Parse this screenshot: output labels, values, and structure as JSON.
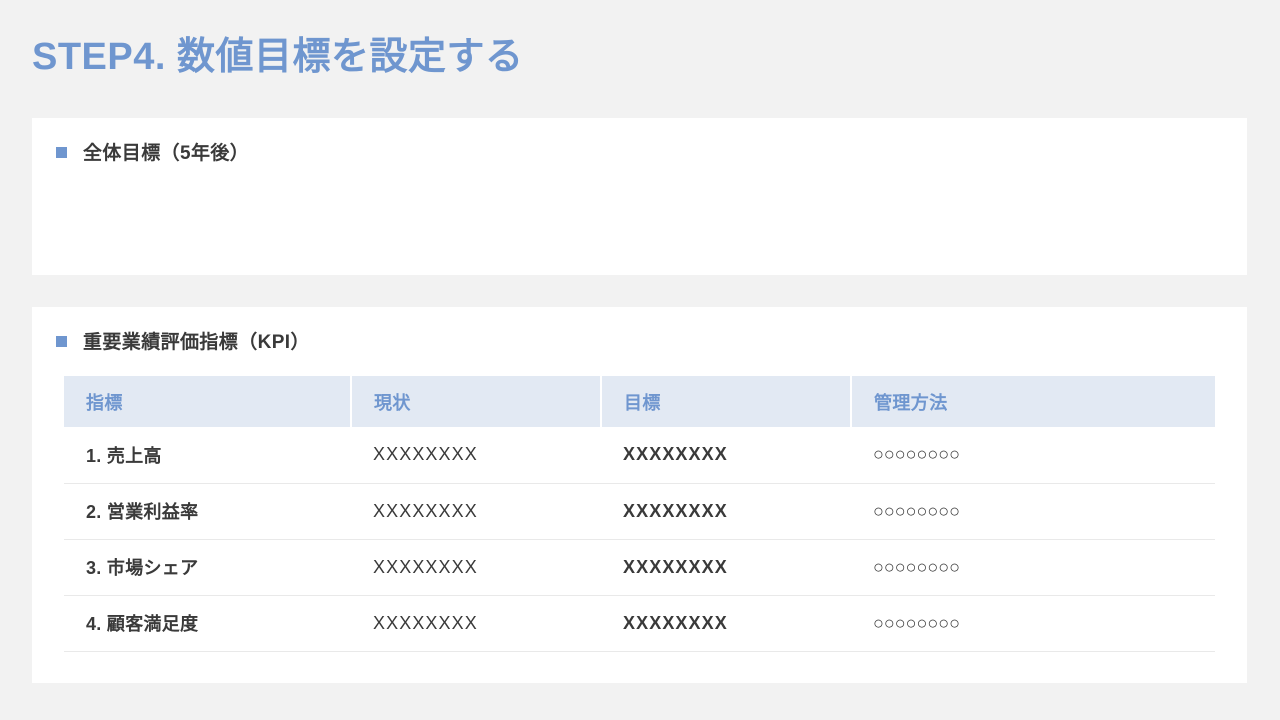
{
  "slide": {
    "title": "STEP4. 数値目標を設定する",
    "accent_color": "#6f96cf",
    "background_color": "#f2f2f2",
    "card_color": "#ffffff"
  },
  "goal_card": {
    "bullet_icon": "square-bullet-icon",
    "heading": "全体目標（5年後）",
    "body": ""
  },
  "kpi_card": {
    "bullet_icon": "square-bullet-icon",
    "heading": "重要業績評価指標（KPI）",
    "table": {
      "headers": [
        "指標",
        "現状",
        "目標",
        "管理方法"
      ],
      "header_background": "#e2e9f3",
      "header_text_color": "#6f96cf",
      "rows": [
        {
          "name": "1. 売上高",
          "current": "XXXXXXXX",
          "target": "XXXXXXXX",
          "management": "○○○○○○○○"
        },
        {
          "name": "2. 営業利益率",
          "current": "XXXXXXXX",
          "target": "XXXXXXXX",
          "management": "○○○○○○○○"
        },
        {
          "name": "3. 市場シェア",
          "current": "XXXXXXXX",
          "target": "XXXXXXXX",
          "management": "○○○○○○○○"
        },
        {
          "name": "4. 顧客満足度",
          "current": "XXXXXXXX",
          "target": "XXXXXXXX",
          "management": "○○○○○○○○"
        }
      ]
    }
  }
}
